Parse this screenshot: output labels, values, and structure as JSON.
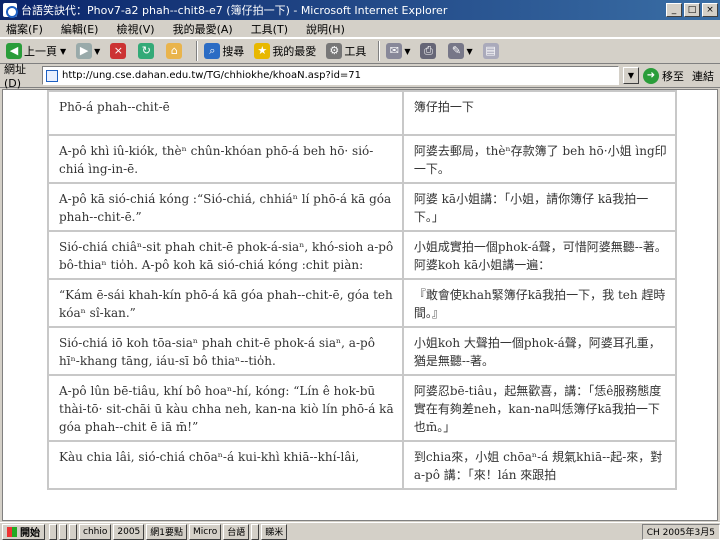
{
  "window": {
    "title": "台語笑訣代：Phov7-a2 phah--chit8-e7 (簿仔拍一下) - Microsoft Internet Explorer",
    "minimize": "_",
    "maximize": "□",
    "close": "×"
  },
  "menu": [
    "檔案(F)",
    "編輯(E)",
    "檢視(V)",
    "我的最愛(A)",
    "工具(T)",
    "說明(H)"
  ],
  "toolbar": {
    "back": "上一頁",
    "search": "搜尋",
    "favorites": "我的最愛",
    "tools": "工具"
  },
  "address": {
    "label": "網址(D)",
    "url": "http://ung.cse.dahan.edu.tw/TG/chhiokhe/khoaN.asp?id=71",
    "go": "移至",
    "links": "連結"
  },
  "rows": [
    {
      "left": "Phō-á phah--chit-ē",
      "right": "簿仔拍一下"
    },
    {
      "left": "A-pô khì iû-kiók, thèⁿ chûn-khóan phō-á beh hō· sió-chiá ìng-in-ē.",
      "right": "阿婆去郵局，thèⁿ存款簿了 beh hō·小姐 ìng印一下。"
    },
    {
      "left": "A-pô kā sió-chiá kóng :“Sió-chiá, chhiáⁿ lí phō-á kā góa phah--chit-ē.”",
      "right": "阿婆 kā小姐講：「小姐，請你簿仔 kā我拍一下。」"
    },
    {
      "left": "Sió-chiá chiâⁿ-sit phah chit-ē phok-á-siaⁿ, khó-sioh a-pô bô-thiaⁿ tio̍h. A-pô koh kā sió-chiá kóng :chit piàn:",
      "right": "小姐成實拍一個phok-á聲，可惜阿婆無聽--著。阿婆koh kā小姐講一遍："
    },
    {
      "left": "“Kám ē-sái khah-kín phō-á kā góa phah--chit-ē, góa teh kóaⁿ sî-kan.”",
      "right": "『敢會使khah緊簿仔kā我拍一下，我 teh 趕時間。』"
    },
    {
      "left": "Sió-chiá iō koh tōa-siaⁿ phah chit-ē phok-á siaⁿ, a-pô hīⁿ-khang tāng, iáu-sī bô thiaⁿ--tio̍h.",
      "right": "小姐koh 大聲拍一個phok-á聲，阿婆耳孔重，猶是無聽--著。"
    },
    {
      "left": "A-pô lûn bē-tiâu, khí bô hoaⁿ-hí, kóng: “Lín ê hok-bū thài-tō· sit-chāi ū kàu chha neh, kan-na kiò lín phō-á kā góa phah--chit ē iā m̄!”",
      "right": "阿婆忍bē-tiâu，起無歡喜，講：「恁ê服務態度實在有夠差neh，kan-na叫恁簿仔kā我拍一下也m̄。」"
    },
    {
      "left": "Kàu chia lâi, sió-chiá chōaⁿ-á kui-khì khiā--khí-lâi,",
      "right": "到chia來，小姐 chōaⁿ-á 規氣khiā--起-來，對 a-pô 講：「來！lán 來跟拍"
    }
  ],
  "taskbar": {
    "start": "開始",
    "tasks": [
      "",
      "",
      "",
      "chhio",
      "2005",
      "網1要點",
      "Micro",
      "台語",
      "",
      "睇米",
      ""
    ],
    "tray": "CH  2005年3月5"
  }
}
